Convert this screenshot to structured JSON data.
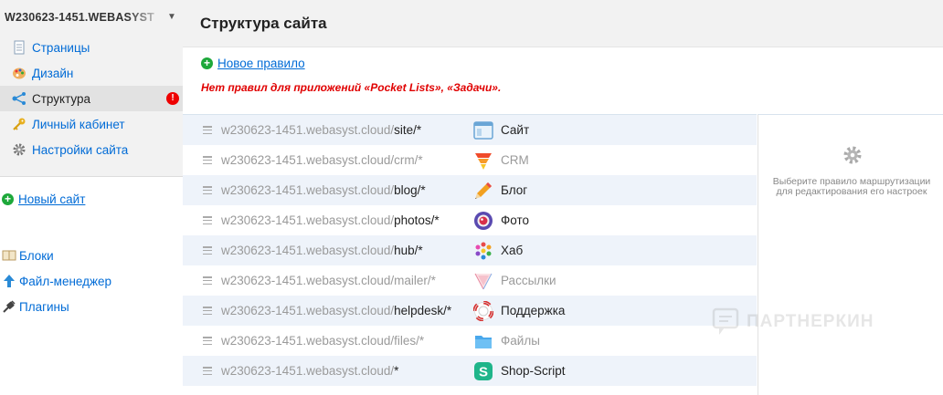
{
  "sidebar": {
    "site_name": "W230623-1451.WEBASYST",
    "menu": [
      {
        "label": "Страницы",
        "icon": "pages-icon"
      },
      {
        "label": "Дизайн",
        "icon": "palette-icon"
      },
      {
        "label": "Структура",
        "icon": "structure-icon",
        "active": true,
        "alert": "!"
      },
      {
        "label": "Личный кабинет",
        "icon": "key-icon"
      },
      {
        "label": "Настройки сайта",
        "icon": "gear-icon"
      }
    ],
    "new_site": "Новый сайт",
    "tools": [
      {
        "label": "Блоки",
        "icon": "blocks-icon"
      },
      {
        "label": "Файл-менеджер",
        "icon": "upload-arrow-icon"
      },
      {
        "label": "Плагины",
        "icon": "plug-icon"
      }
    ]
  },
  "main": {
    "title": "Структура сайта",
    "new_rule": "Новое правило",
    "warning": "Нет правил для приложений «Pocket Lists», «Задачи».",
    "rules": [
      {
        "domain": "w230623-1451.webasyst.cloud/",
        "path": "site/*",
        "app": "Сайт",
        "icon": "site-app-icon",
        "enabled": true
      },
      {
        "domain": "w230623-1451.webasyst.cloud/",
        "path": "crm/*",
        "app": "CRM",
        "icon": "crm-app-icon",
        "enabled": false
      },
      {
        "domain": "w230623-1451.webasyst.cloud/",
        "path": "blog/*",
        "app": "Блог",
        "icon": "blog-app-icon",
        "enabled": true
      },
      {
        "domain": "w230623-1451.webasyst.cloud/",
        "path": "photos/*",
        "app": "Фото",
        "icon": "photos-app-icon",
        "enabled": true
      },
      {
        "domain": "w230623-1451.webasyst.cloud/",
        "path": "hub/*",
        "app": "Хаб",
        "icon": "hub-app-icon",
        "enabled": true
      },
      {
        "domain": "w230623-1451.webasyst.cloud/",
        "path": "mailer/*",
        "app": "Рассылки",
        "icon": "mailer-app-icon",
        "enabled": false
      },
      {
        "domain": "w230623-1451.webasyst.cloud/",
        "path": "helpdesk/*",
        "app": "Поддержка",
        "icon": "helpdesk-app-icon",
        "enabled": true
      },
      {
        "domain": "w230623-1451.webasyst.cloud/",
        "path": "files/*",
        "app": "Файлы",
        "icon": "files-app-icon",
        "enabled": false
      },
      {
        "domain": "w230623-1451.webasyst.cloud/",
        "path": "*",
        "app": "Shop-Script",
        "icon": "shop-script-app-icon",
        "enabled": true
      }
    ],
    "hint": "Выберите правило маршрутизации для редактирования его настроек"
  },
  "watermark": "ПАРТНЕРКИН",
  "colors": {
    "link": "#006bd6",
    "warning": "#e00000",
    "add": "#1da83a",
    "row_alt": "#eef3fa"
  }
}
